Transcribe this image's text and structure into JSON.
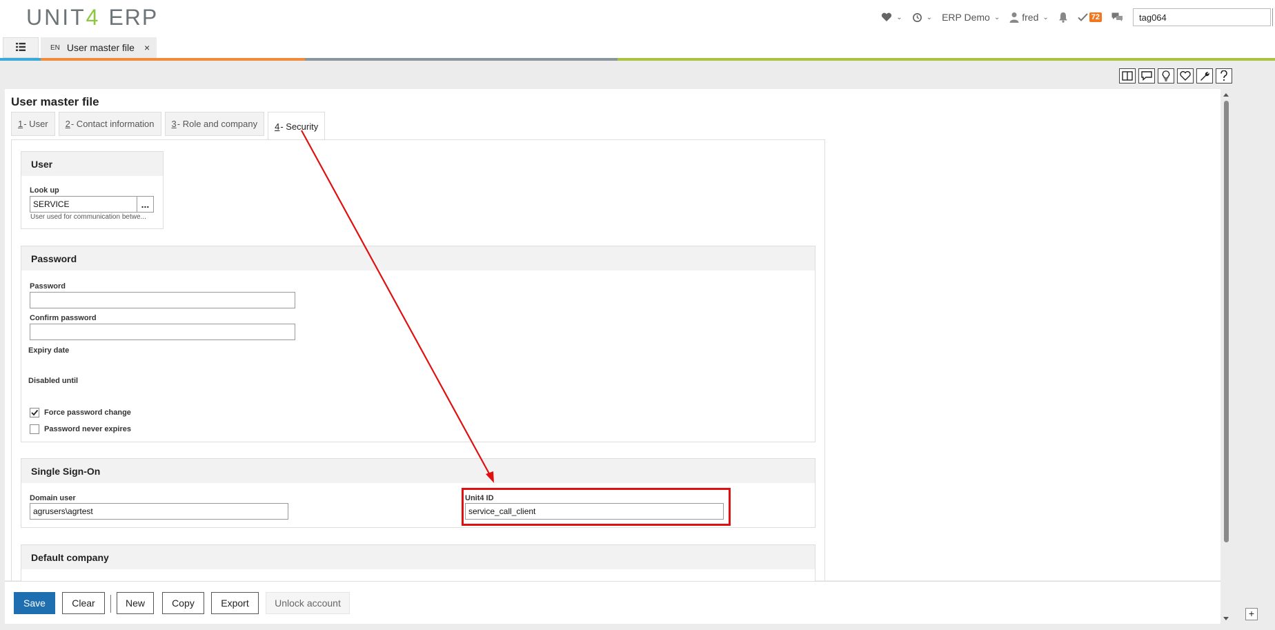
{
  "header": {
    "logo_brand": "UNIT",
    "logo_four": "4",
    "logo_product": "ERP",
    "company": "ERP Demo",
    "user": "fred",
    "tasks_count": "72",
    "search_value": "tag064"
  },
  "tabbar": {
    "doc_tab_lang": "EN",
    "doc_tab_title": "User master file",
    "close_glyph": "×"
  },
  "colors": {
    "accent_blue": "#1f6fb0",
    "brand_green": "#8dc63f",
    "highlight_red": "#e01010",
    "colorbar_orange": "#f08a3c",
    "colorbar_gray": "#8a969e",
    "colorbar_green": "#a9c23f"
  },
  "page": {
    "title": "User master file"
  },
  "tabs": [
    {
      "num": "1",
      "label": " - User"
    },
    {
      "num": "2",
      "label": " - Contact information"
    },
    {
      "num": "3",
      "label": " - Role and company"
    },
    {
      "num": "4",
      "label": " - Security"
    }
  ],
  "user_section": {
    "title": "User",
    "lookup_label": "Look up",
    "lookup_value": "SERVICE",
    "lookup_button": "...",
    "hint": "User used for communication betwe..."
  },
  "password_section": {
    "title": "Password",
    "password_label": "Password",
    "password_value": "",
    "confirm_label": "Confirm password",
    "confirm_value": "",
    "expiry_label": "Expiry date",
    "disabled_label": "Disabled until",
    "force_change_label": "Force password change",
    "force_change_checked": true,
    "never_expires_label": "Password never expires",
    "never_expires_checked": false
  },
  "sso_section": {
    "title": "Single Sign-On",
    "domain_label": "Domain user",
    "domain_value": "agrusers\\agrtest",
    "unit4id_label": "Unit4 ID",
    "unit4id_value": "service_call_client"
  },
  "default_company_section": {
    "title": "Default company"
  },
  "buttons": {
    "save": "Save",
    "clear": "Clear",
    "new": "New",
    "copy": "Copy",
    "export": "Export",
    "unlock": "Unlock account",
    "add": "+"
  },
  "icons": {
    "favorites": "heart-icon",
    "history": "history-icon",
    "user": "user-icon",
    "notifications": "bell-icon",
    "tasks": "check-icon",
    "chat": "chat-icon",
    "menu": "list-icon",
    "toolbar": [
      "split-view-icon",
      "comment-icon",
      "lightbulb-icon",
      "heart-outline-icon",
      "wrench-icon",
      "help-icon"
    ]
  }
}
